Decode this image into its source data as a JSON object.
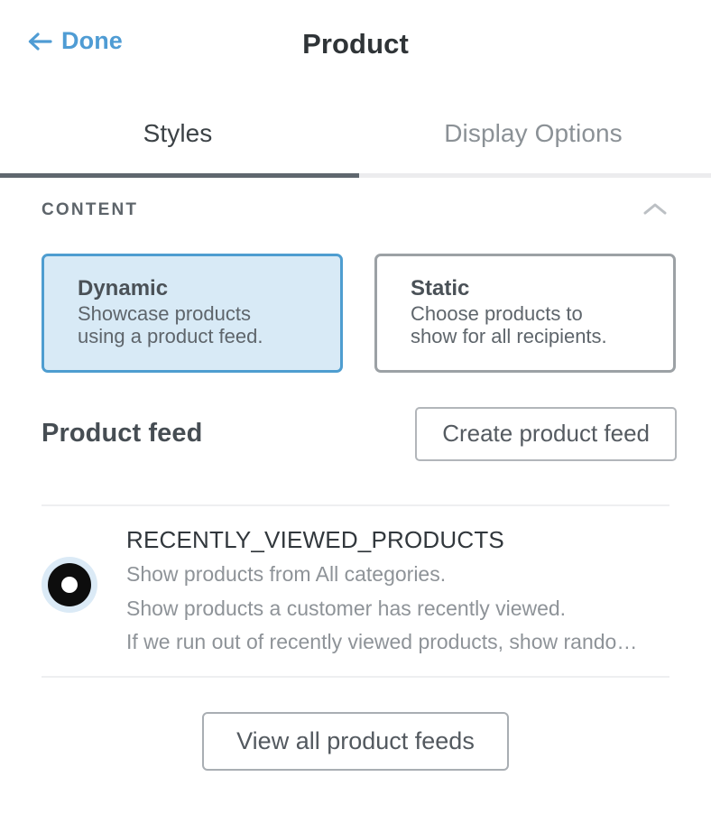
{
  "header": {
    "back_label": "Done",
    "back_icon": "arrow-left-icon",
    "title": "Product"
  },
  "tabs": [
    {
      "label": "Styles",
      "active": true
    },
    {
      "label": "Display Options",
      "active": false
    }
  ],
  "content_section": {
    "title": "CONTENT",
    "collapse_icon": "chevron-up-icon"
  },
  "option_cards": [
    {
      "title": "Dynamic",
      "description": "Showcase products\nusing a product feed.",
      "selected": true
    },
    {
      "title": "Static",
      "description": "Choose products to\nshow for all recipients.",
      "selected": false
    }
  ],
  "product_feed": {
    "heading": "Product feed",
    "create_button": "Create product feed",
    "selected_feed": {
      "name": "RECENTLY_VIEWED_PRODUCTS",
      "line1": "Show products from All categories.",
      "line2": "Show products a customer has recently viewed.",
      "line3": "If we run out of recently viewed products, show rando…",
      "radio_icon": "radio-selected-icon",
      "selected": true
    },
    "view_all_button": "View all product feeds"
  },
  "colors": {
    "accent_blue": "#4f9cd4",
    "selected_card_bg": "#d8eaf6",
    "selected_card_border": "#4e9dd0",
    "card_border": "#9ca1a5",
    "active_tab_underline": "#5f676e",
    "title_text": "#2f3437",
    "muted_text": "#8e9398",
    "divider": "#eeeff1"
  }
}
